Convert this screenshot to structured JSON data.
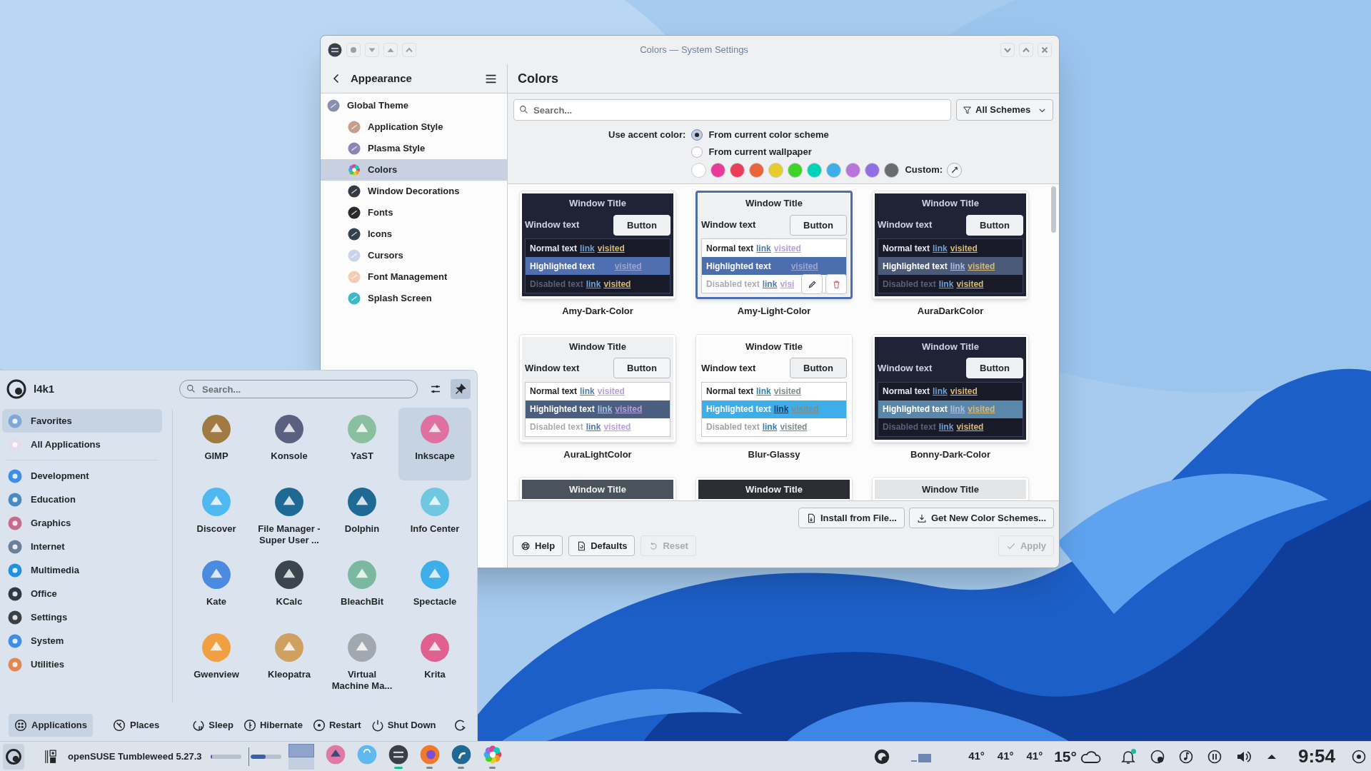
{
  "settings_window": {
    "title": "Colors — System Settings",
    "sidebar": {
      "title": "Appearance",
      "items": [
        {
          "label": "Global Theme",
          "selected": false,
          "children": [
            {
              "label": "Application Style",
              "selected": false
            },
            {
              "label": "Plasma Style",
              "selected": false
            },
            {
              "label": "Colors",
              "selected": true
            },
            {
              "label": "Window Decorations",
              "selected": false
            },
            {
              "label": "Fonts",
              "selected": false
            },
            {
              "label": "Icons",
              "selected": false
            },
            {
              "label": "Cursors",
              "selected": false
            },
            {
              "label": "Font Management",
              "selected": false
            },
            {
              "label": "Splash Screen",
              "selected": false
            }
          ]
        }
      ]
    },
    "page": {
      "title": "Colors",
      "search": {
        "placeholder": "Search..."
      },
      "filter": "All Schemes",
      "accent": {
        "label": "Use accent color:",
        "options": [
          {
            "label": "From current color scheme",
            "selected": true
          },
          {
            "label": "From current wallpaper",
            "selected": false
          }
        ],
        "swatches": [
          {
            "color": "#ffffff",
            "selected": false
          },
          {
            "color": "#e93a9a",
            "selected": false
          },
          {
            "color": "#e93d58",
            "selected": false
          },
          {
            "color": "#e9643a",
            "selected": false
          },
          {
            "color": "#e8cb2d",
            "selected": false
          },
          {
            "color": "#3dd425",
            "selected": false
          },
          {
            "color": "#00d3b8",
            "selected": false
          },
          {
            "color": "#3daee9",
            "selected": false
          },
          {
            "color": "#b875dc",
            "selected": false
          },
          {
            "color": "#926ee4",
            "selected": false
          },
          {
            "color": "#686b6f",
            "selected": false
          }
        ],
        "custom": "Custom:"
      },
      "schemes": [
        {
          "name": "Amy-Dark-Color",
          "selected": false,
          "hovered": false,
          "kind": "dark",
          "color": "#4f6fb0",
          "title": "Window Title",
          "window_text": "Window text",
          "button": "Button",
          "normal": {
            "text": "Normal text",
            "link": "link",
            "visited": "visited"
          },
          "highlighted": {
            "text": "Highlighted text",
            "visited": "visited"
          },
          "disabled": {
            "text": "Disabled text",
            "link": "link",
            "visited": "visited"
          }
        },
        {
          "name": "Amy-Light-Color",
          "selected": true,
          "hovered": true,
          "kind": "light",
          "color": "#4b6eaf",
          "title": "Window Title",
          "window_text": "Window text",
          "button": "Button",
          "normal": {
            "text": "Normal text",
            "link": "link",
            "visited": "visited"
          },
          "highlighted": {
            "text": "Highlighted text",
            "visited": "visited"
          },
          "disabled": {
            "text": "Disabled text",
            "link": "link",
            "visited": "visi"
          }
        },
        {
          "name": "AuraDarkColor",
          "selected": false,
          "hovered": false,
          "kind": "dark",
          "color": "#4a5a78",
          "title": "Window Title",
          "window_text": "Window text",
          "button": "Button",
          "normal": {
            "text": "Normal text",
            "link": "link",
            "visited": "visited"
          },
          "highlighted": {
            "text": "Highlighted text",
            "link": "link",
            "visited": "visited"
          },
          "disabled": {
            "text": "Disabled text",
            "link": "link",
            "visited": "visited"
          }
        },
        {
          "name": "AuraLightColor",
          "selected": false,
          "hovered": false,
          "kind": "light",
          "color": "#4a5f80",
          "title": "Window Title",
          "window_text": "Window text",
          "button": "Button",
          "normal": {
            "text": "Normal text",
            "link": "link",
            "visited": "visited"
          },
          "highlighted": {
            "text": "Highlighted text",
            "link": "link",
            "visited": "visited"
          },
          "disabled": {
            "text": "Disabled text",
            "link": "link",
            "visited": "visited"
          }
        },
        {
          "name": "Blur-Glassy",
          "selected": false,
          "hovered": false,
          "kind": "white",
          "color": "#3daee9",
          "title": "Window Title",
          "window_text": "Window text",
          "button": "Button",
          "normal": {
            "text": "Normal text",
            "link": "link",
            "visited": "visited"
          },
          "highlighted": {
            "text": "Highlighted text",
            "link": "link",
            "visited": "visited"
          },
          "disabled": {
            "text": "Disabled text",
            "link": "link",
            "visited": "visited"
          }
        },
        {
          "name": "Bonny-Dark-Color",
          "selected": false,
          "hovered": false,
          "kind": "dark",
          "color": "#5b88aa",
          "title": "Window Title",
          "window_text": "Window text",
          "button": "Button",
          "normal": {
            "text": "Normal text",
            "link": "link",
            "visited": "visited"
          },
          "highlighted": {
            "text": "Highlighted text",
            "link": "link",
            "visited": "visited"
          },
          "disabled": {
            "text": "Disabled text",
            "link": "link",
            "visited": "visited"
          }
        },
        {
          "selected": false,
          "hovered": false,
          "kind": "slate",
          "title": "Window Title"
        },
        {
          "selected": false,
          "hovered": false,
          "kind": "charcoal",
          "title": "Window Title"
        },
        {
          "selected": false,
          "hovered": false,
          "kind": "grey",
          "title": "Window Title"
        }
      ],
      "buttons_top": [
        {
          "label": "Install from File...",
          "disabled": false
        },
        {
          "label": "Get New Color Schemes...",
          "disabled": false
        }
      ],
      "buttons_left": [
        {
          "label": "Help",
          "disabled": false
        },
        {
          "label": "Defaults",
          "disabled": false
        },
        {
          "label": "Reset",
          "disabled": true
        }
      ],
      "apply": {
        "label": "Apply",
        "disabled": true
      }
    }
  },
  "launcher": {
    "user": "l4k1",
    "search": {
      "placeholder": "Search..."
    },
    "pinned": true,
    "categories": [
      {
        "label": "Favorites",
        "selected": true
      },
      {
        "label": "All Applications",
        "selected": false
      },
      {
        "label": "Development",
        "selected": false
      },
      {
        "label": "Education",
        "selected": false
      },
      {
        "label": "Graphics",
        "selected": false
      },
      {
        "label": "Internet",
        "selected": false
      },
      {
        "label": "Multimedia",
        "selected": false
      },
      {
        "label": "Office",
        "selected": false
      },
      {
        "label": "Settings",
        "selected": false
      },
      {
        "label": "System",
        "selected": false
      },
      {
        "label": "Utilities",
        "selected": false
      }
    ],
    "apps": [
      {
        "label": "GIMP",
        "selected": false
      },
      {
        "label": "Konsole",
        "selected": false
      },
      {
        "label": "YaST",
        "selected": false
      },
      {
        "label": "Inkscape",
        "selected": true
      },
      {
        "label": "Discover",
        "selected": false
      },
      {
        "label": "File Manager - Super User ...",
        "selected": false
      },
      {
        "label": "Dolphin",
        "selected": false
      },
      {
        "label": "Info Center",
        "selected": false
      },
      {
        "label": "Kate",
        "selected": false
      },
      {
        "label": "KCalc",
        "selected": false
      },
      {
        "label": "BleachBit",
        "selected": false
      },
      {
        "label": "Spectacle",
        "selected": false
      },
      {
        "label": "Gwenview",
        "selected": false
      },
      {
        "label": "Kleopatra",
        "selected": false
      },
      {
        "label": "Virtual Machine Ma...",
        "selected": false
      },
      {
        "label": "Krita",
        "selected": false
      }
    ],
    "tabs": [
      {
        "label": "Applications",
        "selected": true
      },
      {
        "label": "Places",
        "selected": false
      }
    ],
    "power": [
      "Sleep",
      "Hibernate",
      "Restart",
      "Shut Down"
    ]
  },
  "taskbar": {
    "window_title": "openSUSE Tumbleweed 5.27.3",
    "monitors": [
      {
        "level": 0.05
      },
      {
        "level": 0.5
      }
    ],
    "tasks": [
      {
        "running": false,
        "active": false
      },
      {
        "running": false,
        "active": false
      },
      {
        "running": true,
        "active": true
      },
      {
        "running": true,
        "active": false
      },
      {
        "running": true,
        "active": false
      },
      {
        "running": true,
        "active": false
      }
    ],
    "temperatures": [
      "41°",
      "41°",
      "41°"
    ],
    "weather": "15°",
    "unread_notifications": true,
    "clock": "9:54"
  }
}
